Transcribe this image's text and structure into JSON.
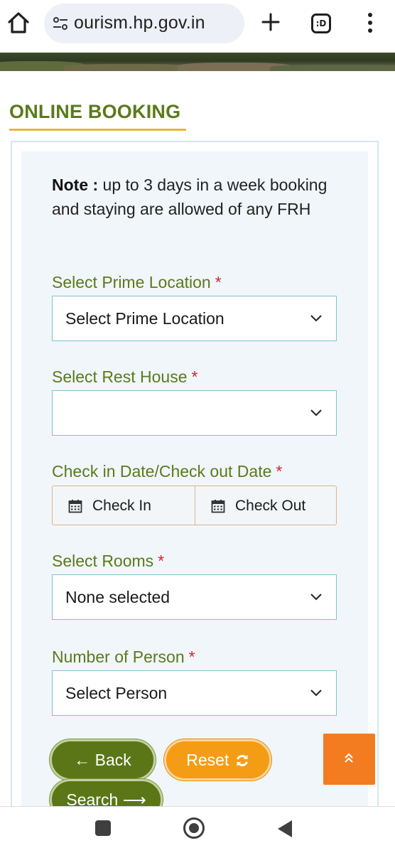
{
  "browser": {
    "url": "ourism.hp.gov.in",
    "tab_count": ":D"
  },
  "page": {
    "heading": "ONLINE BOOKING",
    "note_label": "Note :",
    "note_text": " up to 3 days in a week booking and staying are allowed of any FRH"
  },
  "form": {
    "required_mark": "*",
    "prime_location": {
      "label": "Select Prime Location",
      "value": "Select Prime Location"
    },
    "rest_house": {
      "label": "Select Rest House",
      "value": ""
    },
    "dates": {
      "label": "Check in Date/Check out Date",
      "check_in": "Check In",
      "check_out": "Check Out"
    },
    "rooms": {
      "label": "Select Rooms",
      "value": "None selected"
    },
    "persons": {
      "label": "Number of Person",
      "value": "Select Person"
    }
  },
  "buttons": {
    "back": "← Back",
    "reset": "Reset",
    "search": "Search ⟶"
  },
  "icons": {
    "home": "home-icon",
    "site_info": "tune-icon",
    "new_tab": "plus-icon",
    "tab_switcher": "tabs-icon",
    "menu": "more-vert-icon",
    "dropdown": "chevron-down-icon",
    "calendar": "calendar-icon",
    "refresh": "refresh-icon",
    "scroll_top": "double-chevron-up-icon"
  },
  "colors": {
    "accent_green": "#5b7a1a",
    "accent_orange": "#f59c15",
    "required_red": "#d0262b",
    "underline_gold": "#e8b63a",
    "scroll_top_orange": "#f47c20"
  }
}
